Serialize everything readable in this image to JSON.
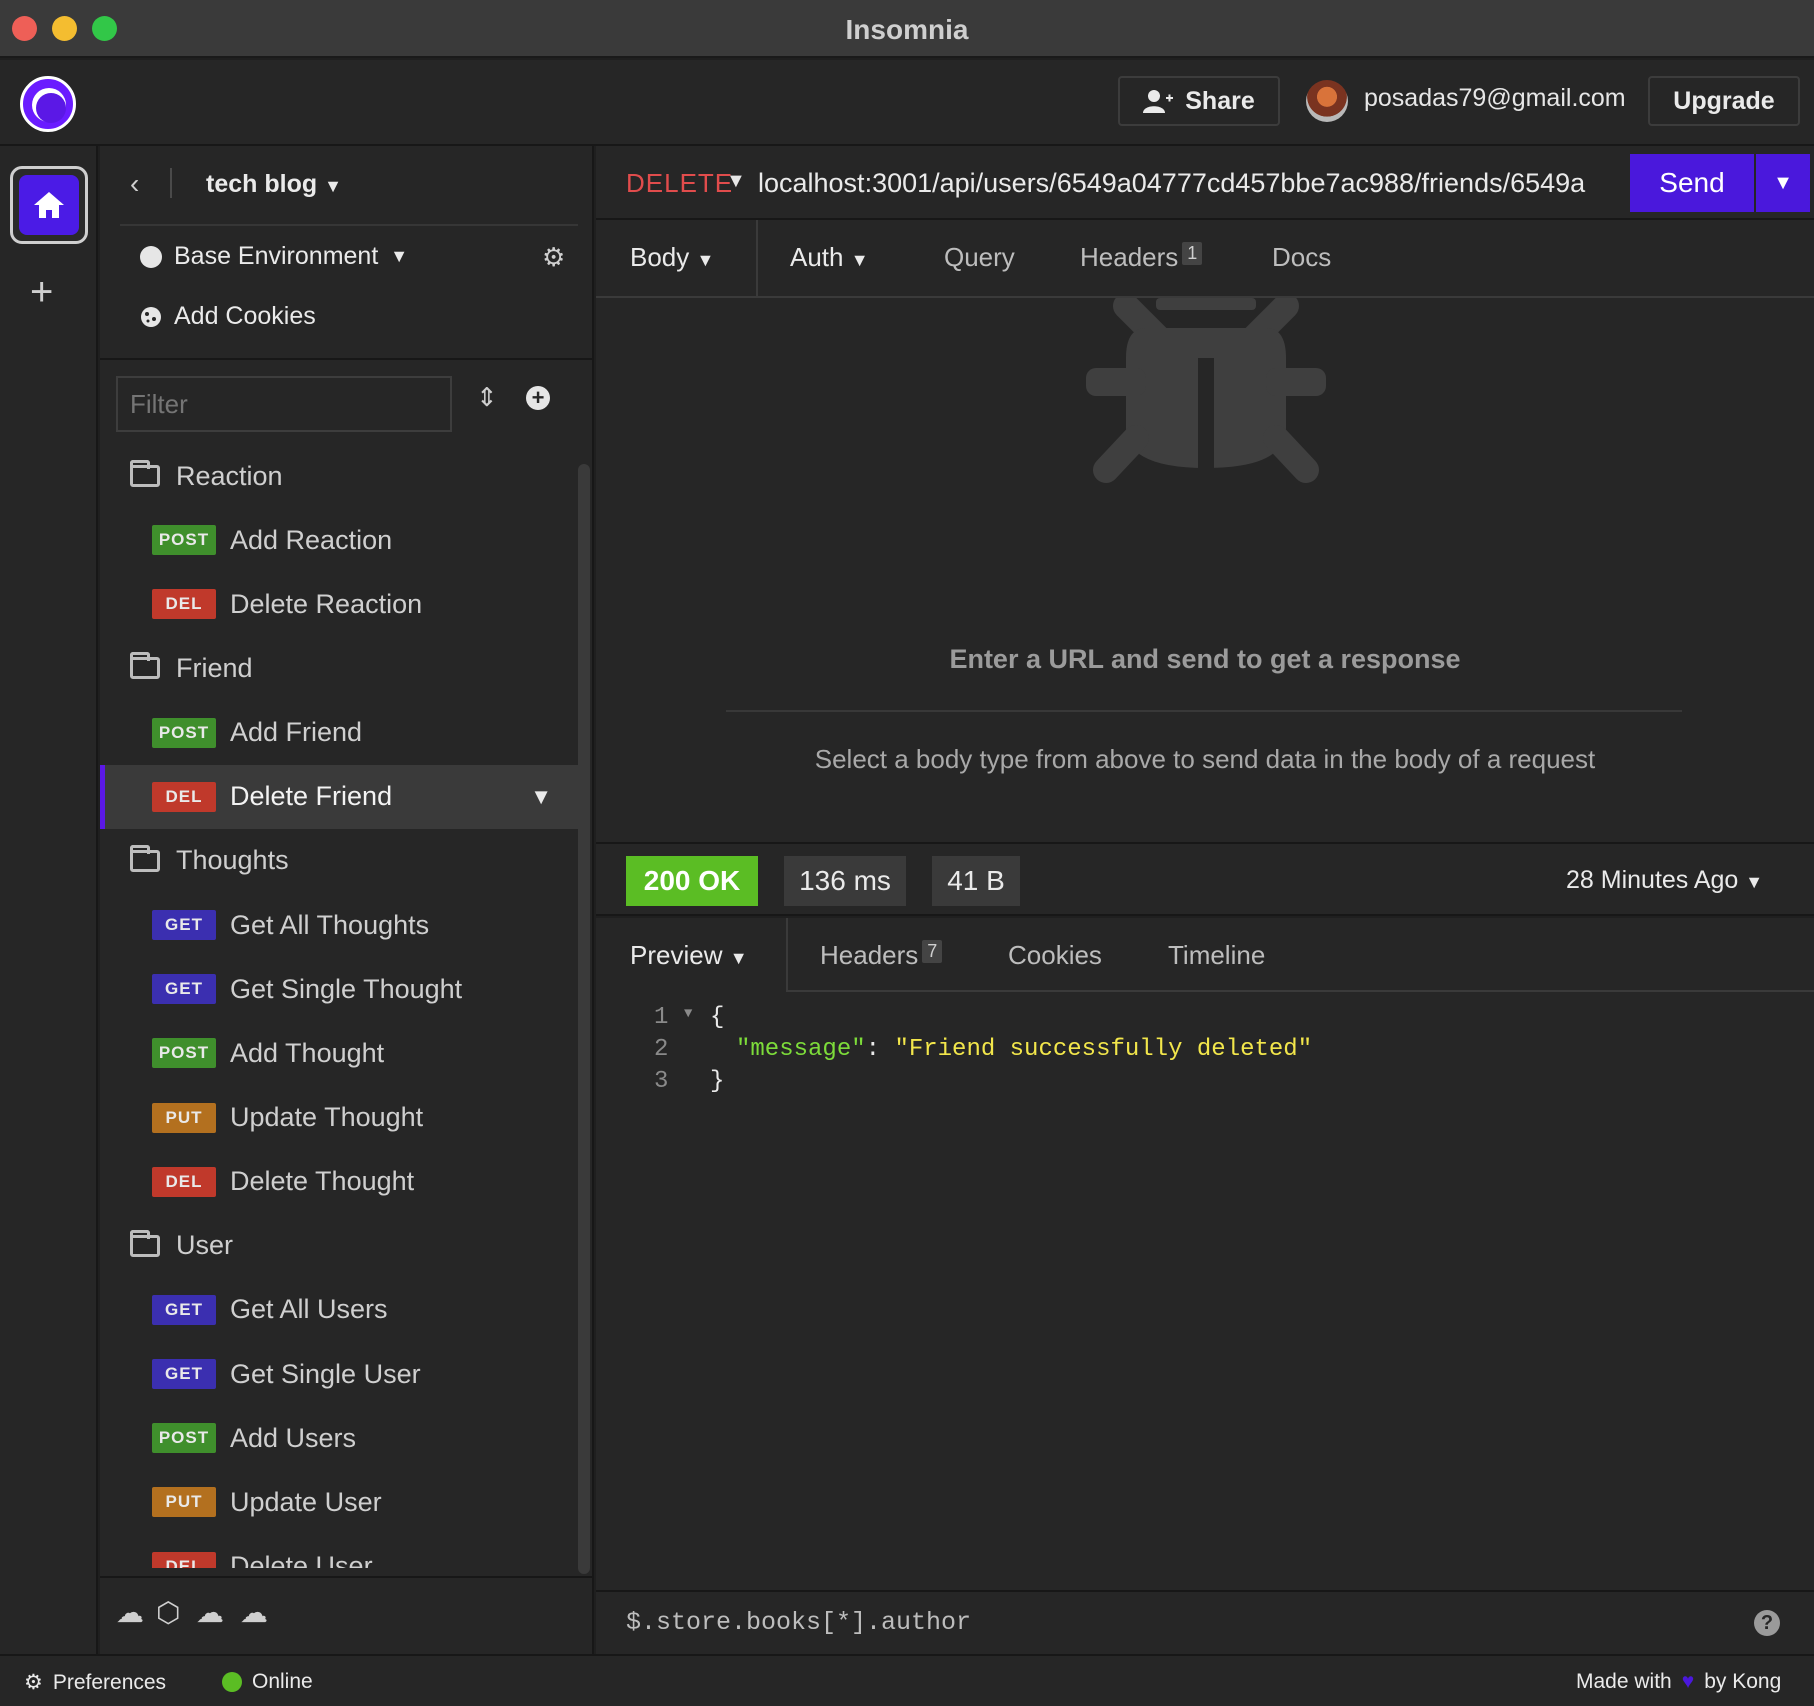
{
  "window": {
    "title": "Insomnia"
  },
  "header": {
    "share_label": "Share",
    "account_email": "posadas79@gmail.com",
    "upgrade_label": "Upgrade"
  },
  "sidebar": {
    "workspace_name": "tech blog",
    "environment": "Base Environment",
    "cookies_label": "Add Cookies",
    "filter_placeholder": "Filter",
    "tree": [
      {
        "type": "folder",
        "label": "Reaction"
      },
      {
        "type": "request",
        "method": "POST",
        "label": "Add Reaction"
      },
      {
        "type": "request",
        "method": "DEL",
        "label": "Delete Reaction"
      },
      {
        "type": "folder",
        "label": "Friend"
      },
      {
        "type": "request",
        "method": "POST",
        "label": "Add Friend"
      },
      {
        "type": "request",
        "method": "DEL",
        "label": "Delete Friend",
        "active": true
      },
      {
        "type": "folder",
        "label": "Thoughts"
      },
      {
        "type": "request",
        "method": "GET",
        "label": "Get All Thoughts"
      },
      {
        "type": "request",
        "method": "GET",
        "label": "Get Single Thought"
      },
      {
        "type": "request",
        "method": "POST",
        "label": "Add Thought"
      },
      {
        "type": "request",
        "method": "PUT",
        "label": "Update Thought"
      },
      {
        "type": "request",
        "method": "DEL",
        "label": "Delete Thought"
      },
      {
        "type": "folder",
        "label": "User"
      },
      {
        "type": "request",
        "method": "GET",
        "label": "Get All Users"
      },
      {
        "type": "request",
        "method": "GET",
        "label": "Get Single User"
      },
      {
        "type": "request",
        "method": "POST",
        "label": "Add Users"
      },
      {
        "type": "request",
        "method": "PUT",
        "label": "Update User"
      },
      {
        "type": "request",
        "method": "DEL",
        "label": "Delete User"
      }
    ]
  },
  "method_colors": {
    "POST": "#3f8f2c",
    "DEL": "#c0392b",
    "GET": "#3b2fb0",
    "PUT": "#b3701f"
  },
  "request": {
    "method": "DELETE",
    "url": "localhost:3001/api/users/6549a04777cd457bbe7ac988/friends/6549a",
    "send_label": "Send",
    "tabs": {
      "body": "Body",
      "auth": "Auth",
      "query": "Query",
      "headers": "Headers",
      "headers_count": "1",
      "docs": "Docs"
    },
    "empty_title": "Enter a URL and send to get a response",
    "empty_hint": "Select a body type from above to send data in the body of a request"
  },
  "response": {
    "status": "200 OK",
    "time": "136 ms",
    "size": "41 B",
    "age": "28 Minutes Ago",
    "tabs": {
      "preview": "Preview",
      "headers": "Headers",
      "headers_count": "7",
      "cookies": "Cookies",
      "timeline": "Timeline"
    },
    "lines": [
      "1",
      "2",
      "3"
    ],
    "json_open": "{",
    "json_key": "\"message\"",
    "json_colon": ": ",
    "json_value": "\"Friend successfully deleted\"",
    "json_close": "}"
  },
  "filter_query": "$.store.books[*].author",
  "statusbar": {
    "preferences": "Preferences",
    "online": "Online",
    "made_with": "Made with",
    "by": "by Kong"
  }
}
